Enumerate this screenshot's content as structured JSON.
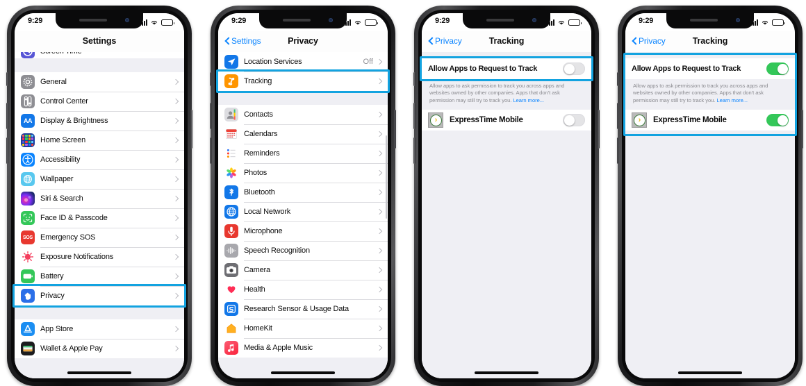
{
  "status_bar": {
    "time": "9:29",
    "signal_icon": "cellular-signal-icon",
    "wifi_icon": "wifi-icon",
    "battery_icon": "battery-icon"
  },
  "highlight_color": "#13A3E0",
  "phones": [
    {
      "id": "phone-settings",
      "nav": {
        "title": "Settings",
        "back_label": "",
        "has_back": false
      },
      "groups": [
        {
          "partial_top": {
            "label": "Screen Time",
            "icon": "screen-time-icon",
            "icon_color": "#5856D6"
          },
          "rows": []
        },
        {
          "rows": [
            {
              "label": "General",
              "icon": "gear-icon",
              "icon_color": "#8E8E93",
              "value": "",
              "highlighted": false
            },
            {
              "label": "Control Center",
              "icon": "control-center-icon",
              "icon_color": "#8E8E93",
              "value": "",
              "highlighted": false
            },
            {
              "label": "Display & Brightness",
              "icon": "display-brightness-icon",
              "icon_color": "#0a84ff",
              "value": "",
              "highlighted": false
            },
            {
              "label": "Home Screen",
              "icon": "home-screen-icon",
              "icon_color": "#1c55c9",
              "value": "",
              "highlighted": false
            },
            {
              "label": "Accessibility",
              "icon": "accessibility-icon",
              "icon_color": "#0a84ff",
              "value": "",
              "highlighted": false
            },
            {
              "label": "Wallpaper",
              "icon": "wallpaper-icon",
              "icon_color": "#3ec3ee",
              "value": "",
              "highlighted": false
            },
            {
              "label": "Siri & Search",
              "icon": "siri-search-icon",
              "icon_color": "#2b2b5e",
              "value": "",
              "highlighted": false
            },
            {
              "label": "Face ID & Passcode",
              "icon": "face-id-icon",
              "icon_color": "#34C759",
              "value": "",
              "highlighted": false
            },
            {
              "label": "Emergency SOS",
              "icon": "emergency-sos-icon",
              "icon_color": "#FF3B30",
              "value": "",
              "highlighted": false
            },
            {
              "label": "Exposure Notifications",
              "icon": "exposure-notifications-icon",
              "icon_color": "#ffffff",
              "value": "",
              "highlighted": false
            },
            {
              "label": "Battery",
              "icon": "battery-settings-icon",
              "icon_color": "#34C759",
              "value": "",
              "highlighted": false
            },
            {
              "label": "Privacy",
              "icon": "privacy-hand-icon",
              "icon_color": "#0a84ff",
              "value": "",
              "highlighted": true
            }
          ]
        },
        {
          "rows": [
            {
              "label": "App Store",
              "icon": "app-store-icon",
              "icon_color": "#0a84ff",
              "value": "",
              "highlighted": false
            },
            {
              "label": "Wallet & Apple Pay",
              "icon": "wallet-apple-pay-icon",
              "icon_color": "#1c1c1e",
              "value": "",
              "highlighted": false
            }
          ]
        }
      ]
    },
    {
      "id": "phone-privacy",
      "nav": {
        "title": "Privacy",
        "back_label": "Settings",
        "has_back": true
      },
      "groups": [
        {
          "rows": [
            {
              "label": "Location Services",
              "icon": "location-services-icon",
              "icon_color": "#0a84ff",
              "value": "Off",
              "highlighted": false
            },
            {
              "label": "Tracking",
              "icon": "tracking-icon",
              "icon_color": "#FF9500",
              "value": "",
              "highlighted": true
            }
          ]
        },
        {
          "rows": [
            {
              "label": "Contacts",
              "icon": "contacts-icon",
              "icon_color": "#b0b0b5",
              "value": "",
              "highlighted": false
            },
            {
              "label": "Calendars",
              "icon": "calendars-icon",
              "icon_color": "#ffffff",
              "value": "",
              "highlighted": false
            },
            {
              "label": "Reminders",
              "icon": "reminders-icon",
              "icon_color": "#ffffff",
              "value": "",
              "highlighted": false
            },
            {
              "label": "Photos",
              "icon": "photos-icon",
              "icon_color": "#ffffff",
              "value": "",
              "highlighted": false
            },
            {
              "label": "Bluetooth",
              "icon": "bluetooth-icon",
              "icon_color": "#0a84ff",
              "value": "",
              "highlighted": false
            },
            {
              "label": "Local Network",
              "icon": "local-network-icon",
              "icon_color": "#0a84ff",
              "value": "",
              "highlighted": false
            },
            {
              "label": "Microphone",
              "icon": "microphone-icon",
              "icon_color": "#FF3B30",
              "value": "",
              "highlighted": false
            },
            {
              "label": "Speech Recognition",
              "icon": "speech-recognition-icon",
              "icon_color": "#8E8E93",
              "value": "",
              "highlighted": false
            },
            {
              "label": "Camera",
              "icon": "camera-icon",
              "icon_color": "#6e6e73",
              "value": "",
              "highlighted": false
            },
            {
              "label": "Health",
              "icon": "health-icon",
              "icon_color": "#ffffff",
              "value": "",
              "highlighted": false
            },
            {
              "label": "Research Sensor & Usage Data",
              "icon": "research-sensor-icon",
              "icon_color": "#0a84ff",
              "value": "",
              "highlighted": false
            },
            {
              "label": "HomeKit",
              "icon": "homekit-icon",
              "icon_color": "#FF9500",
              "value": "",
              "highlighted": false
            },
            {
              "label": "Media & Apple Music",
              "icon": "media-apple-music-icon",
              "icon_color": "#FA2D48",
              "value": "",
              "highlighted": false
            }
          ]
        }
      ]
    },
    {
      "id": "phone-tracking-off",
      "nav": {
        "title": "Tracking",
        "back_label": "Privacy",
        "has_back": true
      },
      "tracking": {
        "allow_label": "Allow Apps to Request to Track",
        "allow_on": false,
        "footnote": "Allow apps to ask permission to track you across apps and websites owned by other companies. Apps that don't ask permission may still try to track you. ",
        "footnote_link": "Learn more...",
        "apps": [
          {
            "name": "ExpressTime Mobile",
            "icon": "expresstime-mobile-icon",
            "on": false
          }
        ]
      },
      "highlight": "allow-row"
    },
    {
      "id": "phone-tracking-on",
      "nav": {
        "title": "Tracking",
        "back_label": "Privacy",
        "has_back": true
      },
      "tracking": {
        "allow_label": "Allow Apps to Request to Track",
        "allow_on": true,
        "footnote": "Allow apps to ask permission to track you across apps and websites owned by other companies. Apps that don't ask permission may still try to track you. ",
        "footnote_link": "Learn more...",
        "apps": [
          {
            "name": "ExpressTime Mobile",
            "icon": "expresstime-mobile-icon",
            "on": true
          }
        ]
      },
      "highlight": "whole-section"
    }
  ]
}
